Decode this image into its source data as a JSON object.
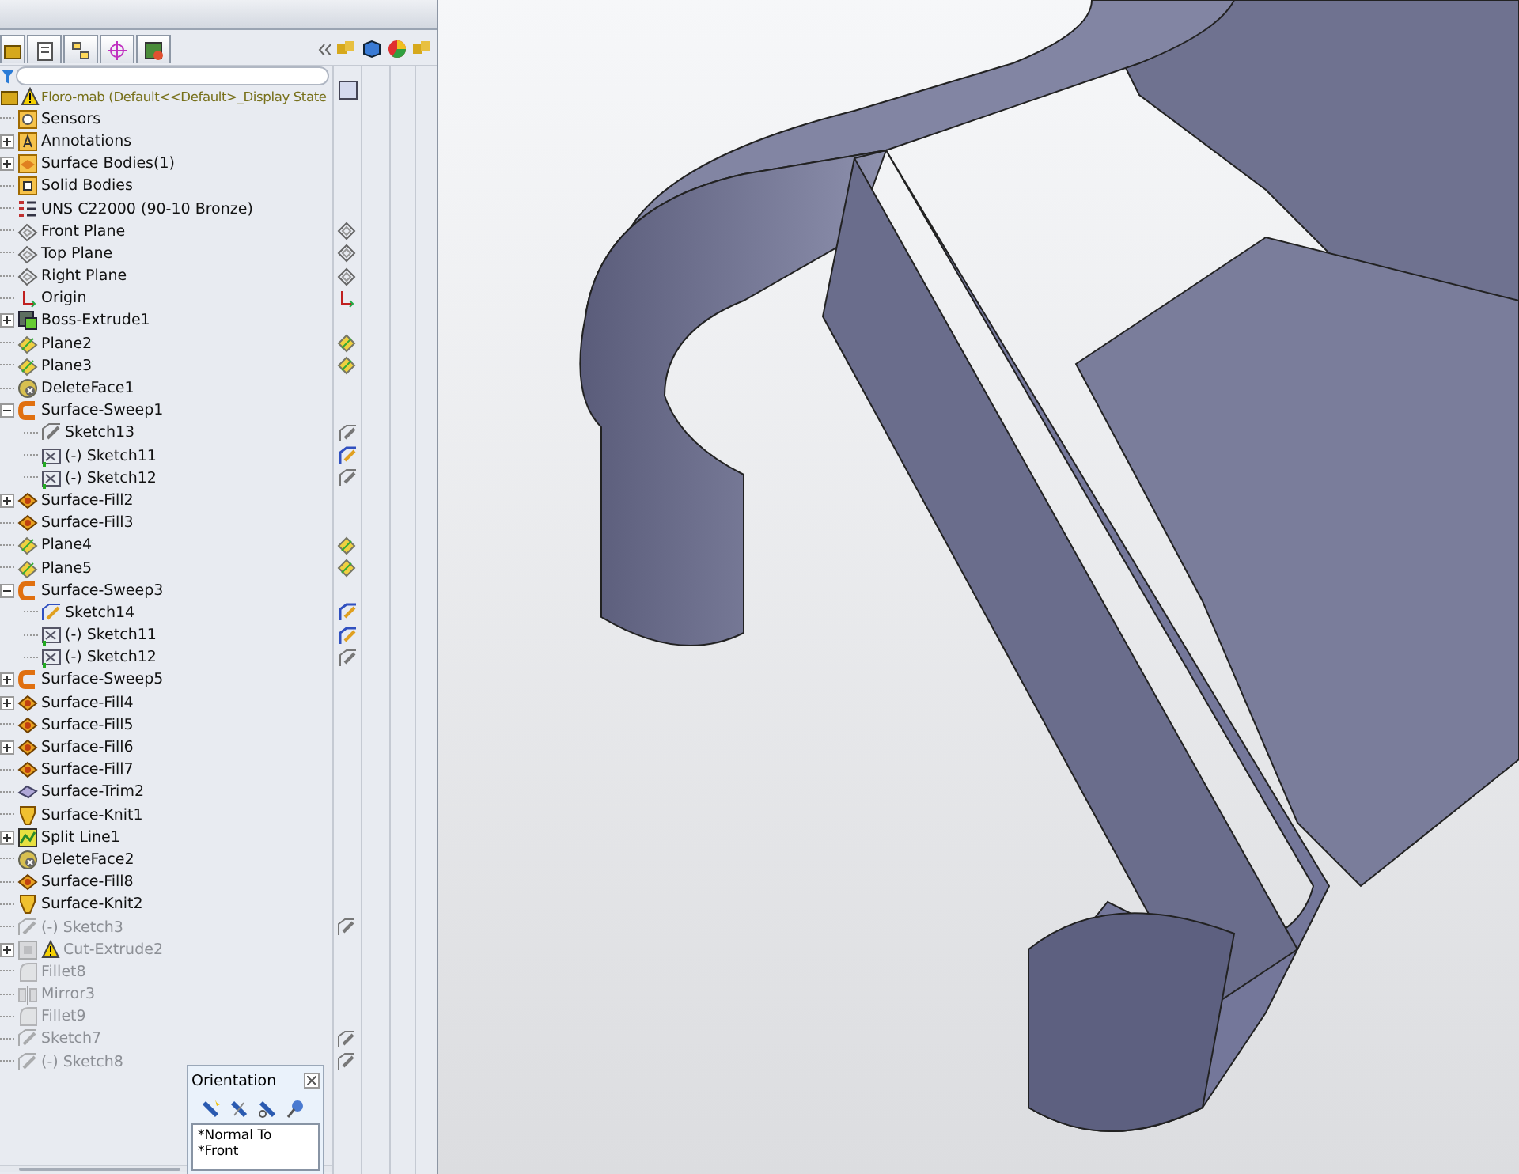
{
  "tree": {
    "root": {
      "label": "Floro-mab  (Default<<Default>_Display State",
      "warning": true
    },
    "items": [
      {
        "label": "Sensors",
        "kind": "sensors"
      },
      {
        "label": "Annotations",
        "kind": "annotations",
        "expanded": false
      },
      {
        "label": "Surface Bodies(1)",
        "kind": "bodies",
        "expanded": false
      },
      {
        "label": "Solid Bodies",
        "kind": "folder"
      },
      {
        "label": "UNS C22000 (90-10 Bronze)",
        "kind": "material"
      },
      {
        "label": "Front Plane",
        "kind": "plane",
        "column_mark": {
          "kind": "plane"
        }
      },
      {
        "label": "Top Plane",
        "kind": "plane",
        "column_mark": {
          "kind": "plane"
        }
      },
      {
        "label": "Right Plane",
        "kind": "plane",
        "column_mark": {
          "kind": "plane"
        }
      },
      {
        "label": "Origin",
        "kind": "origin",
        "column_mark": {
          "kind": "origin"
        }
      },
      {
        "label": "Boss-Extrude1",
        "kind": "extrude",
        "expanded": false
      },
      {
        "label": "Plane2",
        "kind": "ref-plane",
        "column_mark": {
          "kind": "ref-plane"
        }
      },
      {
        "label": "Plane3",
        "kind": "ref-plane",
        "column_mark": {
          "kind": "ref-plane"
        }
      },
      {
        "label": "DeleteFace1",
        "kind": "delete"
      },
      {
        "label": "Surface-Sweep1",
        "kind": "sweep",
        "expanded": true,
        "children": [
          {
            "label": "Sketch13",
            "kind": "sketch",
            "column_mark": {
              "kind": "sketch"
            }
          },
          {
            "label": "(-) Sketch11",
            "kind": "sketch-3d",
            "column_mark": {
              "kind": "sketch-active"
            }
          },
          {
            "label": "(-) Sketch12",
            "kind": "sketch-3d",
            "column_mark": {
              "kind": "sketch"
            }
          }
        ]
      },
      {
        "label": "Surface-Fill2",
        "kind": "fill",
        "expanded": false
      },
      {
        "label": "Surface-Fill3",
        "kind": "fill"
      },
      {
        "label": "Plane4",
        "kind": "ref-plane",
        "column_mark": {
          "kind": "ref-plane"
        }
      },
      {
        "label": "Plane5",
        "kind": "ref-plane",
        "column_mark": {
          "kind": "ref-plane"
        }
      },
      {
        "label": "Surface-Sweep3",
        "kind": "sweep",
        "expanded": true,
        "children": [
          {
            "label": "Sketch14",
            "kind": "sketch-active",
            "column_mark": {
              "kind": "sketch-active"
            }
          },
          {
            "label": "(-) Sketch11",
            "kind": "sketch-3d",
            "column_mark": {
              "kind": "sketch-active"
            }
          },
          {
            "label": "(-) Sketch12",
            "kind": "sketch-3d",
            "column_mark": {
              "kind": "sketch"
            }
          }
        ]
      },
      {
        "label": "Surface-Sweep5",
        "kind": "sweep",
        "expanded": false
      },
      {
        "label": "Surface-Fill4",
        "kind": "fill",
        "expanded": false
      },
      {
        "label": "Surface-Fill5",
        "kind": "fill"
      },
      {
        "label": "Surface-Fill6",
        "kind": "fill",
        "expanded": false
      },
      {
        "label": "Surface-Fill7",
        "kind": "fill"
      },
      {
        "label": "Surface-Trim2",
        "kind": "trim"
      },
      {
        "label": "Surface-Knit1",
        "kind": "knit"
      },
      {
        "label": "Split Line1",
        "kind": "split",
        "expanded": false
      },
      {
        "label": "DeleteFace2",
        "kind": "delete"
      },
      {
        "label": "Surface-Fill8",
        "kind": "fill"
      },
      {
        "label": "Surface-Knit2",
        "kind": "knit"
      },
      {
        "label": "(-) Sketch3",
        "kind": "sketch",
        "suppressed": true,
        "column_mark": {
          "kind": "sketch"
        }
      },
      {
        "label": "Cut-Extrude2",
        "kind": "cut",
        "suppressed": true,
        "warning": true,
        "expanded": false
      },
      {
        "label": "Fillet8",
        "kind": "fillet",
        "suppressed": true
      },
      {
        "label": "Mirror3",
        "kind": "mirror",
        "suppressed": true
      },
      {
        "label": "Fillet9",
        "kind": "fillet",
        "suppressed": true
      },
      {
        "label": "Sketch7",
        "kind": "sketch",
        "suppressed": true,
        "column_mark": {
          "kind": "sketch"
        }
      },
      {
        "label": "(-) Sketch8",
        "kind": "sketch",
        "suppressed": true,
        "column_mark": {
          "kind": "sketch"
        }
      }
    ]
  },
  "orientation": {
    "title": "Orientation",
    "views": [
      "*Normal To",
      "*Front"
    ]
  }
}
